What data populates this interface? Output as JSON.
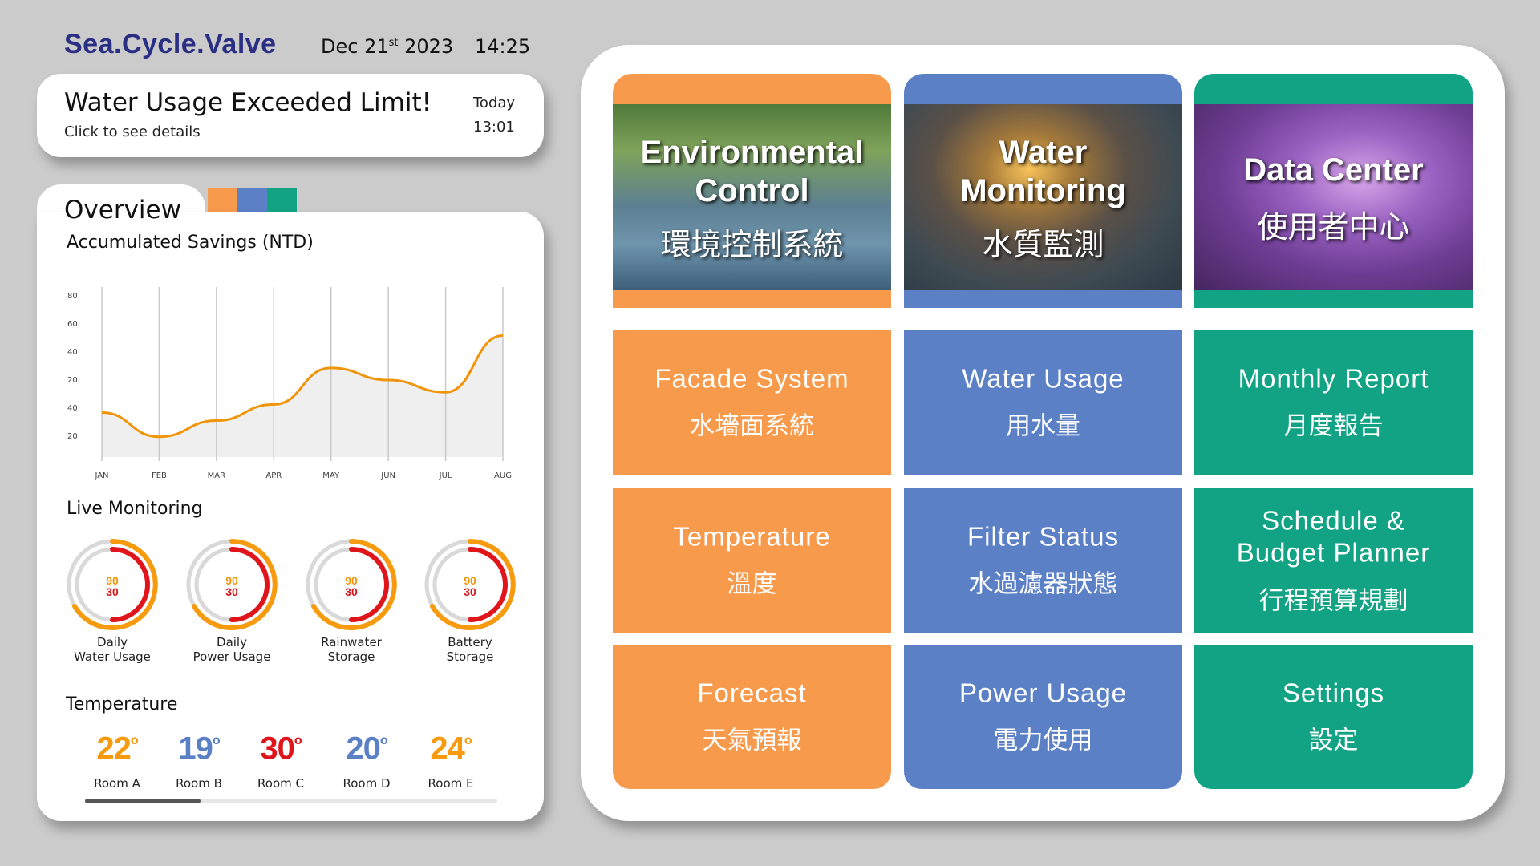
{
  "header": {
    "brand": "Sea.Cycle.Valve",
    "date_main": "Dec 21",
    "date_suffix": "st",
    "date_year": " 2023",
    "time": "14:25"
  },
  "alert": {
    "title": "Water Usage Exceeded Limit!",
    "subtitle": "Click to see details",
    "day": "Today",
    "time": "13:01"
  },
  "overview": {
    "title": "Overview",
    "swatch_colors": [
      "#f79a4c",
      "#5b80c6",
      "#12a384"
    ],
    "savings_label": "Accumulated Savings (NTD)",
    "live_label": "Live Monitoring",
    "temperature_label": "Temperature"
  },
  "chart_data": {
    "type": "area",
    "title": "Accumulated Savings (NTD)",
    "categories": [
      "JAN",
      "FEB",
      "MAR",
      "APR",
      "MAY",
      "JUN",
      "JUL",
      "AUG"
    ],
    "y_tick_labels": [
      "80",
      "60",
      "40",
      "20",
      "40",
      "20"
    ],
    "values": [
      22,
      10,
      18,
      26,
      44,
      38,
      32,
      60
    ],
    "ylim": [
      0,
      80
    ],
    "line_color": "#f0950a",
    "fill_color": "#ececec",
    "grid": "vertical"
  },
  "gauges": [
    {
      "top": "90",
      "bottom": "30",
      "label_line1": "Daily",
      "label_line2": "Water Usage"
    },
    {
      "top": "90",
      "bottom": "30",
      "label_line1": "Daily",
      "label_line2": "Power Usage"
    },
    {
      "top": "90",
      "bottom": "30",
      "label_line1": "Rainwater",
      "label_line2": "Storage"
    },
    {
      "top": "90",
      "bottom": "30",
      "label_line1": "Battery",
      "label_line2": "Storage"
    }
  ],
  "gauge_colors": {
    "outer": "#f79a0e",
    "inner": "#e0141b",
    "track": "#d9d9d9",
    "top_text": "#f0950a",
    "bottom_text": "#d8141b"
  },
  "temperatures": [
    {
      "value": "22",
      "unit": "o",
      "room": "Room A",
      "color": "#f79a0e"
    },
    {
      "value": "19",
      "unit": "o",
      "room": "Room B",
      "color": "#5b80c6"
    },
    {
      "value": "30",
      "unit": "o",
      "room": "Room C",
      "color": "#e0141b"
    },
    {
      "value": "20",
      "unit": "o",
      "room": "Room D",
      "color": "#5b80c6"
    },
    {
      "value": "24",
      "unit": "o",
      "room": "Room E",
      "color": "#f79a0e"
    }
  ],
  "temp_scroll_fraction": 0.28,
  "heroes": [
    {
      "en_line1": "Environmental",
      "en_line2": "Control",
      "zh": "環境控制系統",
      "color": "#f79a4c",
      "icon": "building-photo"
    },
    {
      "en_line1": "Water",
      "en_line2": "Monitoring",
      "zh": "水質監測",
      "color": "#5b80c6",
      "icon": "water-pipe-photo"
    },
    {
      "en_line1": "Data Center",
      "en_line2": "",
      "zh": "使用者中心",
      "color": "#12a384",
      "icon": "data-hand-photo"
    }
  ],
  "tiles": [
    {
      "en": "Facade System",
      "zh": "水墻面系統",
      "color": "#f79a4c"
    },
    {
      "en": "Water Usage",
      "zh": "用水量",
      "color": "#5b80c6"
    },
    {
      "en": "Monthly Report",
      "zh": "月度報告",
      "color": "#12a384"
    },
    {
      "en": "Temperature",
      "zh": "溫度",
      "color": "#f79a4c"
    },
    {
      "en": "Filter Status",
      "zh": "水過濾器狀態",
      "color": "#5b80c6"
    },
    {
      "en": "Schedule & Budget Planner",
      "zh": "行程預算規劃",
      "color": "#12a384"
    },
    {
      "en": "Forecast",
      "zh": "天氣預報",
      "color": "#f79a4c"
    },
    {
      "en": "Power Usage",
      "zh": "電力使用",
      "color": "#5b80c6"
    },
    {
      "en": "Settings",
      "zh": "設定",
      "color": "#12a384"
    }
  ]
}
